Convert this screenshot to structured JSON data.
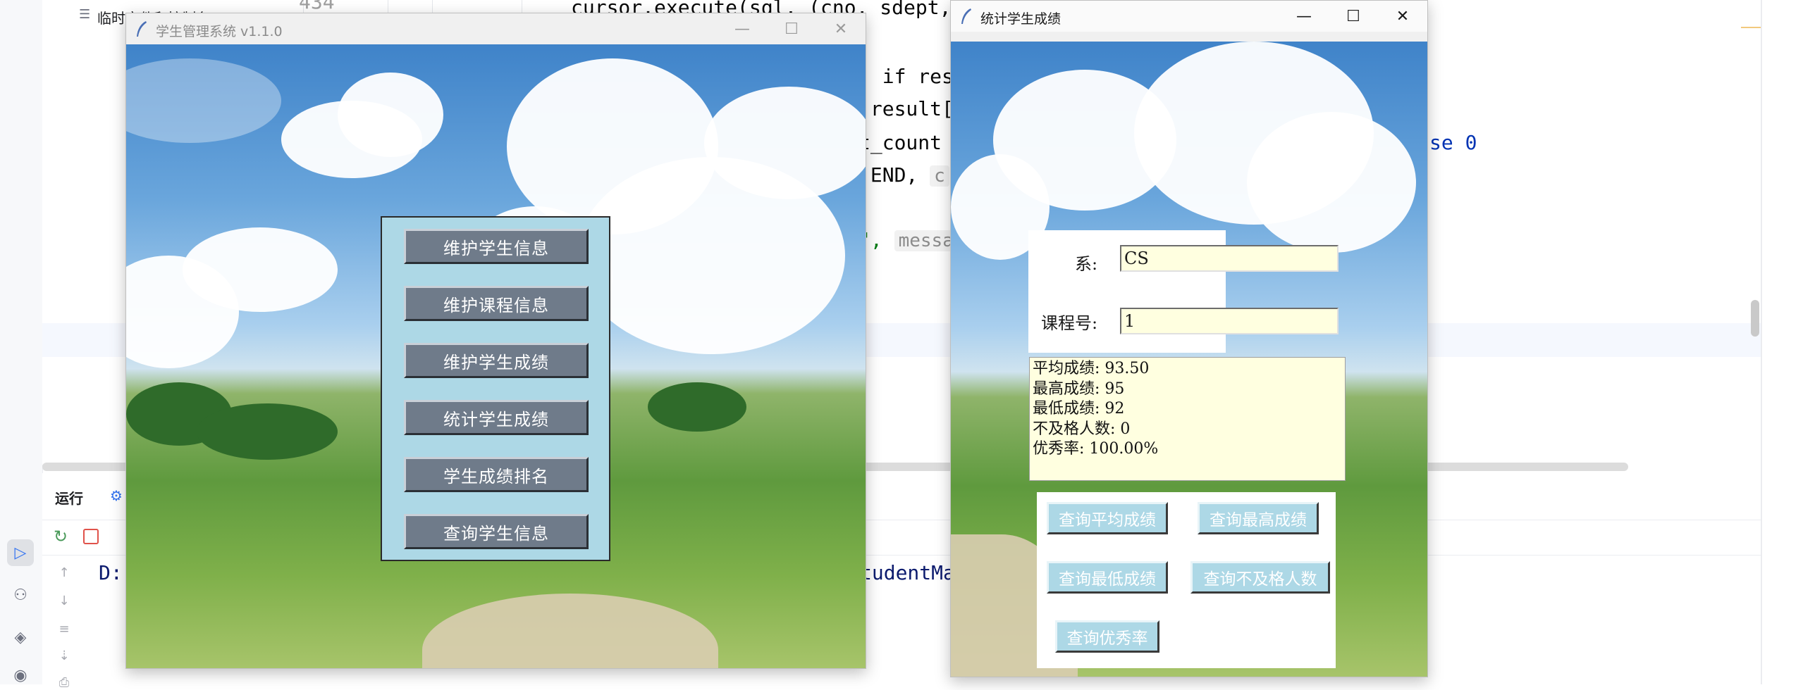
{
  "ide": {
    "gutter_line_number": "434",
    "project_item_label": "临时文件和控制台",
    "code_lines": [
      {
        "text": "cursor.execute(sql, (cno, sdept, s"
      },
      {
        "text": "] if res"
      },
      {
        "text": " result["
      },
      {
        "text": "t_count "
      },
      {
        "text": ".END, "
      },
      {
        "text": "\", "
      },
      {
        "text": ":"
      }
    ],
    "code_keyword_if": "if",
    "code_keyword_else": "se 0",
    "code_hint_c": "c",
    "code_hint_messa": "messa",
    "run_tab_label": "运行",
    "console_prefix": "D:",
    "console_suffix": "tudentMa"
  },
  "main_window": {
    "title": "学生管理系统 v1.1.0",
    "buttons": [
      {
        "label": "维护学生信息"
      },
      {
        "label": "维护课程信息"
      },
      {
        "label": "维护学生成绩"
      },
      {
        "label": "统计学生成绩"
      },
      {
        "label": "学生成绩排名"
      },
      {
        "label": "查询学生信息"
      }
    ]
  },
  "stats_window": {
    "title": "统计学生成绩",
    "dept_label": "系:",
    "dept_value": "CS",
    "course_label": "课程号:",
    "course_value": "1",
    "results": [
      "平均成绩: 93.50",
      "最高成绩: 95",
      "最低成绩: 92",
      "不及格人数: 0",
      "优秀率: 100.00%"
    ],
    "buttons": {
      "avg": "查询平均成绩",
      "max": "查询最高成绩",
      "min": "查询最低成绩",
      "fail": "查询不及格人数",
      "excellent": "查询优秀率"
    }
  },
  "window_controls": {
    "minimize": "—",
    "maximize": "☐",
    "close": "✕"
  },
  "colors": {
    "menu_panel_bg": "#add8e6",
    "menu_button_bg": "#6f7b8a",
    "entry_bg": "#ffffe0",
    "stat_button_bg": "#add8e6",
    "code_keyword": "#0033b3",
    "code_string": "#067d17"
  }
}
